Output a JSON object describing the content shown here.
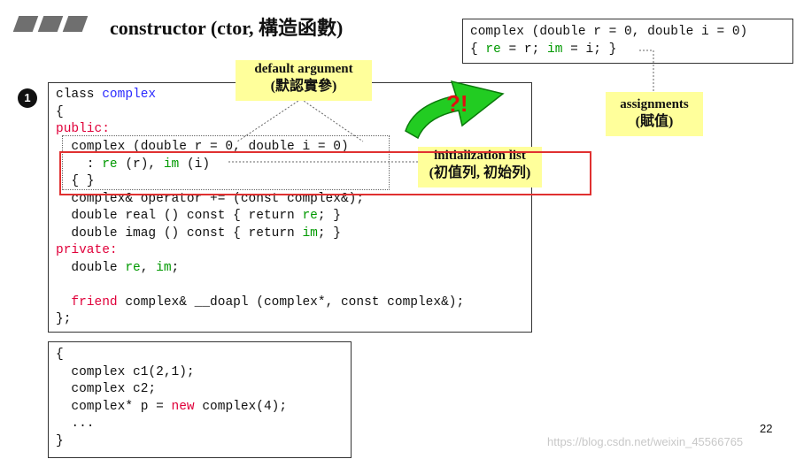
{
  "slide": {
    "title": "constructor (ctor, 構造函數)",
    "bullet_number": "1",
    "page_number": "22",
    "watermark": "https://blog.csdn.net/weixin_45566765"
  },
  "class_code": {
    "l1_kw": "class ",
    "l1_name": "complex",
    "l2": "{",
    "l3": "public:",
    "l4": "  complex (double r = 0, double i = 0)",
    "l5_a": "    : ",
    "l5_re": "re",
    "l5_b": " (r), ",
    "l5_im": "im",
    "l5_c": " (i)",
    "l6": "  { }",
    "l7": "  complex& operator += (const complex&);",
    "l8_a": "  double real () const { return ",
    "l8_re": "re",
    "l8_b": "; }",
    "l9_a": "  double imag () const { return ",
    "l9_im": "im",
    "l9_b": "; }",
    "l10": "private:",
    "l11_a": "  double ",
    "l11_re": "re",
    "l11_b": ", ",
    "l11_im": "im",
    "l11_c": ";",
    "l12_friend": "  friend",
    "l12_rest": " complex& __doapl (complex*, const complex&);",
    "l13": "};"
  },
  "usage_code": {
    "l1": "{",
    "l2": "  complex c1(2,1);",
    "l3": "  complex c2;",
    "l4_a": "  complex* p = ",
    "l4_new": "new",
    "l4_b": " complex(4);",
    "l5": "  ...",
    "l6": "}"
  },
  "alt_code": {
    "l1": "complex (double r = 0, double i = 0)",
    "l2_a": "{ ",
    "l2_re": "re",
    "l2_b": " = r; ",
    "l2_im": "im",
    "l2_c": " = i; }"
  },
  "callouts": {
    "default_argument": "default argument",
    "default_argument_zh": "(默認實參)",
    "initialization_list": "initialization list",
    "initialization_list_zh": "(初值列, 初始列)",
    "assignments": "assignments",
    "assignments_zh": "(賦值)"
  },
  "arrow_label": "?!",
  "colors": {
    "keyword_red": "#e0003a",
    "type_blue": "#2a2aff",
    "member_green": "#009900",
    "callout_yellow": "#ffff9b",
    "highlight_red": "#e03030",
    "arrow_green": "#22cc22"
  }
}
